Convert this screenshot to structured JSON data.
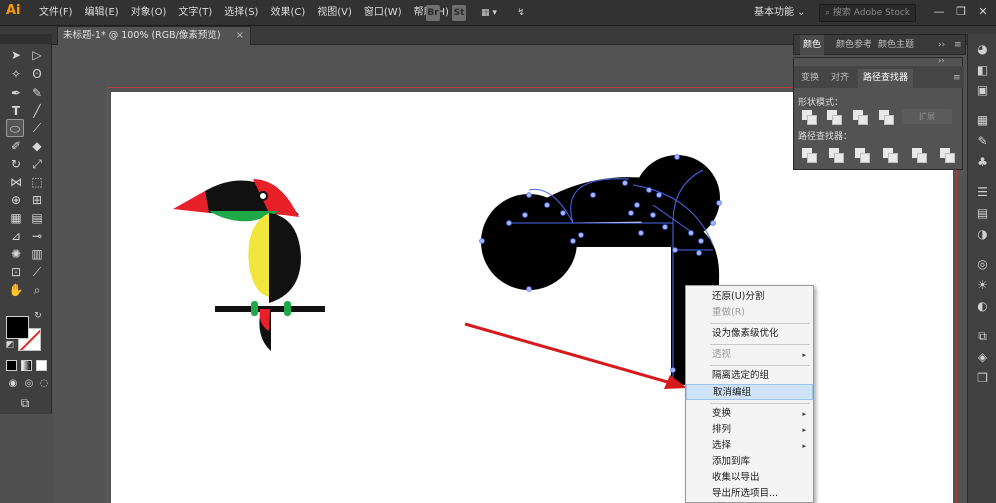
{
  "app": {
    "logo": "Ai"
  },
  "menubar": {
    "items": [
      "文件(F)",
      "编辑(E)",
      "对象(O)",
      "文字(T)",
      "选择(S)",
      "效果(C)",
      "视图(V)",
      "窗口(W)",
      "帮助(H)"
    ],
    "bridge_label": "Br",
    "stock_label": "St",
    "arrange_label": "▦ ▾",
    "gpu_label": "↯",
    "workspace": "基本功能 ⌄",
    "search_placeholder": "搜索 Adobe Stock",
    "window_controls": [
      "—",
      "❐",
      "✕"
    ]
  },
  "tab": {
    "title": "未标题-1* @ 100% (RGB/像素预览)",
    "close": "×"
  },
  "panels": {
    "color_tabs": [
      "颜色",
      "颜色参考",
      "颜色主题"
    ],
    "collapse": "››",
    "menu": "≡",
    "pathfinder_tabs": [
      "变换",
      "对齐",
      "路径查找器"
    ],
    "shape_modes_label": "形状模式：",
    "pathfinders_label": "路径查找器：",
    "expand_label": "扩展"
  },
  "context_menu": {
    "items": [
      {
        "label": "还原(U)分割",
        "disabled": false,
        "submenu": false
      },
      {
        "label": "重做(R)",
        "disabled": true,
        "submenu": false
      },
      {
        "label": "设为像素级优化",
        "disabled": false,
        "submenu": false
      },
      {
        "label": "透视",
        "disabled": true,
        "submenu": true
      },
      {
        "label": "隔离选定的组",
        "disabled": false,
        "submenu": false
      },
      {
        "label": "取消编组",
        "disabled": false,
        "submenu": false,
        "highlighted": true
      },
      {
        "label": "变换",
        "disabled": false,
        "submenu": true
      },
      {
        "label": "排列",
        "disabled": false,
        "submenu": true
      },
      {
        "label": "选择",
        "disabled": false,
        "submenu": true
      },
      {
        "label": "添加到库",
        "disabled": false,
        "submenu": false
      },
      {
        "label": "收集以导出",
        "disabled": false,
        "submenu": false
      },
      {
        "label": "导出所选项目...",
        "disabled": false,
        "submenu": false
      }
    ],
    "submenu_arrow": "▸"
  },
  "colors": {
    "accent_red": "#e8202a",
    "green": "#1ea84a",
    "yellow": "#f0e63c",
    "selection_blue": "#4a6cf0",
    "annotation_arrow": "#d7191c"
  }
}
